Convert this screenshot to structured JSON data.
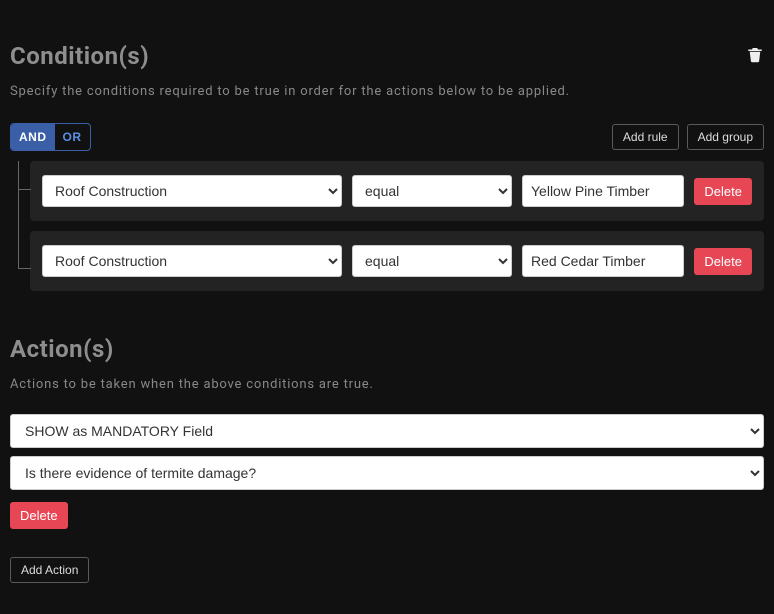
{
  "conditions": {
    "heading": "Condition(s)",
    "subtext": "Specify the conditions required to be true in order for the actions below to be applied.",
    "logic": {
      "and": "AND",
      "or": "OR",
      "active": "and"
    },
    "buttons": {
      "add_rule": "Add rule",
      "add_group": "Add group"
    },
    "rules": [
      {
        "field": "Roof Construction",
        "operator": "equal",
        "value": "Yellow Pine Timber",
        "delete": "Delete"
      },
      {
        "field": "Roof Construction",
        "operator": "equal",
        "value": "Red Cedar Timber",
        "delete": "Delete"
      }
    ]
  },
  "actions": {
    "heading": "Action(s)",
    "subtext": "Actions to be taken when the above conditions are true.",
    "items": [
      {
        "type": "SHOW as MANDATORY Field",
        "target": "Is there evidence of termite damage?",
        "delete": "Delete"
      }
    ],
    "add_button": "Add Action"
  }
}
